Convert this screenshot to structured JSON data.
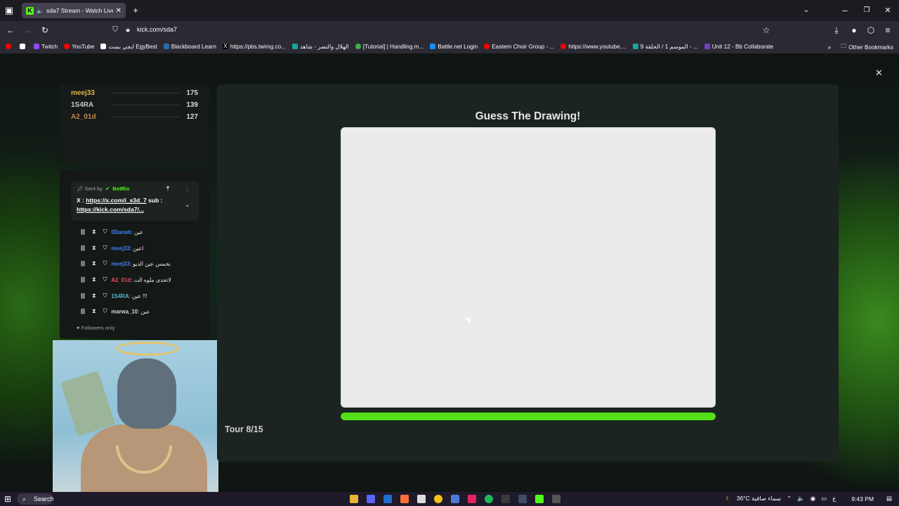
{
  "browser": {
    "tab_title": "sda7 Stream - Watch Live o",
    "url": "kick.com/sda7",
    "new_tab": "+",
    "bookmarks": [
      {
        "label": "Twitch",
        "color": "#9146ff"
      },
      {
        "label": "YouTube",
        "color": "#ff0000"
      },
      {
        "label": "ايجي بست EgyBest",
        "color": "#ffffff"
      },
      {
        "label": "Blackboard Learn",
        "color": "#2b6cb0"
      },
      {
        "label": "https://pbs.twimg.co...",
        "color": "#000000"
      },
      {
        "label": "الهلال والنصر - شاهد",
        "color": "#1aa3a3"
      },
      {
        "label": "[Tutorial] | Handling.m...",
        "color": "#3fae49"
      },
      {
        "label": "Battle.net Login",
        "color": "#148eff"
      },
      {
        "label": "Eastern Choir Group - ...",
        "color": "#ff0000"
      },
      {
        "label": "https://www.youtube....",
        "color": "#ff0000"
      },
      {
        "label": "الموسم 1 / الحلقة 9 - ...",
        "color": "#1aa3a3"
      },
      {
        "label": "Unit 12 - Bb Collaborate",
        "color": "#6f42c1"
      }
    ],
    "other_bookmarks": "Other Bookmarks"
  },
  "leaderboard": [
    {
      "name": "meej33",
      "score": "175",
      "color": "#e0b64a"
    },
    {
      "name": "1S4RA",
      "score": "139",
      "color": "#c9c9c9"
    },
    {
      "name": "A2_01d",
      "score": "127",
      "color": "#c0894b"
    }
  ],
  "chat": {
    "pinned": {
      "sent_by": "Sent by",
      "author": "BotRix",
      "message_prefix": "X : ",
      "link1": "https://x.com/i_s3d_7",
      "middle": " sub : ",
      "link2": "https://kick.com/sda7/..."
    },
    "messages": [
      {
        "user": "0Danah",
        "text": ": عين",
        "color": "#3b82f6"
      },
      {
        "user": "meej33",
        "text": ": اعين",
        "color": "#3b82f6"
      },
      {
        "user": "meej33",
        "text": ": بخمس عين الديو",
        "color": "#3b82f6"
      },
      {
        "user": "A2_01d",
        "text": ": لاتحدى ملوه الت",
        "color": "#ef4a6a"
      },
      {
        "user": "1S4RA",
        "text": ": عين !!!",
        "color": "#53b7c9"
      },
      {
        "user": "marwa_10",
        "text": ": عين",
        "color": "#d7d7d7"
      }
    ],
    "followers_only": "Followers only"
  },
  "game": {
    "title": "Guess The Drawing!",
    "progress": 1.0,
    "tour": "Tour 8/15"
  },
  "taskbar": {
    "search": "Search",
    "weather": "36°C سماء صافية",
    "lang": "ع",
    "time": "9:43 PM"
  }
}
